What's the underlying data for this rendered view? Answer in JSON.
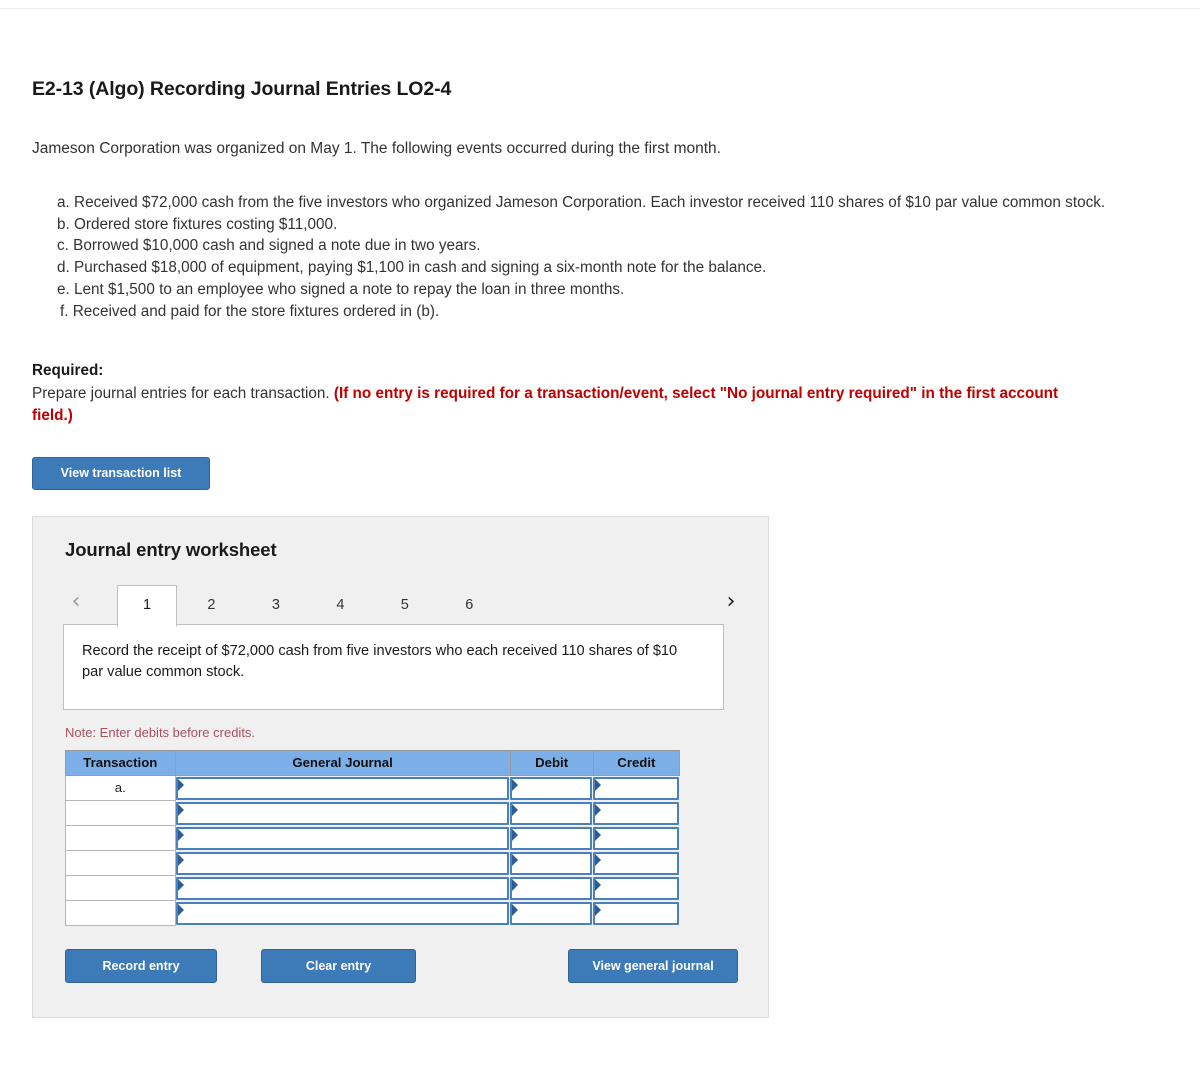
{
  "exercise": {
    "title": "E2-13 (Algo) Recording Journal Entries LO2-4",
    "intro": "Jameson Corporation was organized on May 1. The following events occurred during the first month.",
    "events": [
      {
        "letter": "a.",
        "text": "Received $72,000 cash from the five investors who organized Jameson Corporation. Each investor received 110 shares of $10 par value common stock."
      },
      {
        "letter": "b.",
        "text": "Ordered store fixtures costing $11,000."
      },
      {
        "letter": "c.",
        "text": "Borrowed $10,000 cash and signed a note due in two years."
      },
      {
        "letter": "d.",
        "text": "Purchased $18,000 of equipment, paying $1,100 in cash and signing a six-month note for the balance."
      },
      {
        "letter": "e.",
        "text": "Lent $1,500 to an employee who signed a note to repay the loan in three months."
      },
      {
        "letter": "f.",
        "text": "Received and paid for the store fixtures ordered in (b)."
      }
    ]
  },
  "required": {
    "label": "Required:",
    "text_plain": "Prepare journal entries for each transaction.",
    "text_red": "(If no entry is required for a transaction/event, select \"No journal entry required\" in the first account field.)"
  },
  "toolbar": {
    "view_transaction_list_label": "View transaction list"
  },
  "worksheet": {
    "title": "Journal entry worksheet",
    "nav": {
      "prev_icon": "chevron-left-icon",
      "next_icon": "chevron-right-icon",
      "prev_glyph": "‹",
      "next_glyph": "›"
    },
    "tabs": [
      {
        "label": "1",
        "active": true
      },
      {
        "label": "2",
        "active": false
      },
      {
        "label": "3",
        "active": false
      },
      {
        "label": "4",
        "active": false
      },
      {
        "label": "5",
        "active": false
      },
      {
        "label": "6",
        "active": false
      }
    ],
    "prompt": "Record the receipt of $72,000 cash from five investors who each received 110 shares of $10 par value common stock.",
    "note": "Note: Enter debits before credits.",
    "table": {
      "headers": [
        "Transaction",
        "General Journal",
        "Debit",
        "Credit"
      ],
      "rows": [
        {
          "transaction": "a.",
          "general_journal": "",
          "debit": "",
          "credit": ""
        },
        {
          "transaction": "",
          "general_journal": "",
          "debit": "",
          "credit": ""
        },
        {
          "transaction": "",
          "general_journal": "",
          "debit": "",
          "credit": ""
        },
        {
          "transaction": "",
          "general_journal": "",
          "debit": "",
          "credit": ""
        },
        {
          "transaction": "",
          "general_journal": "",
          "debit": "",
          "credit": ""
        },
        {
          "transaction": "",
          "general_journal": "",
          "debit": "",
          "credit": ""
        }
      ]
    },
    "actions": {
      "record_entry_label": "Record entry",
      "clear_entry_label": "Clear entry",
      "view_general_journal_label": "View general journal"
    }
  },
  "colors": {
    "button_blue": "#3d7ab8",
    "table_header_blue": "#7cafe8",
    "input_border_blue": "#4a81bd",
    "required_red": "#c00000",
    "note_red": "#a9515b",
    "panel_gray": "#f0f0f0"
  }
}
